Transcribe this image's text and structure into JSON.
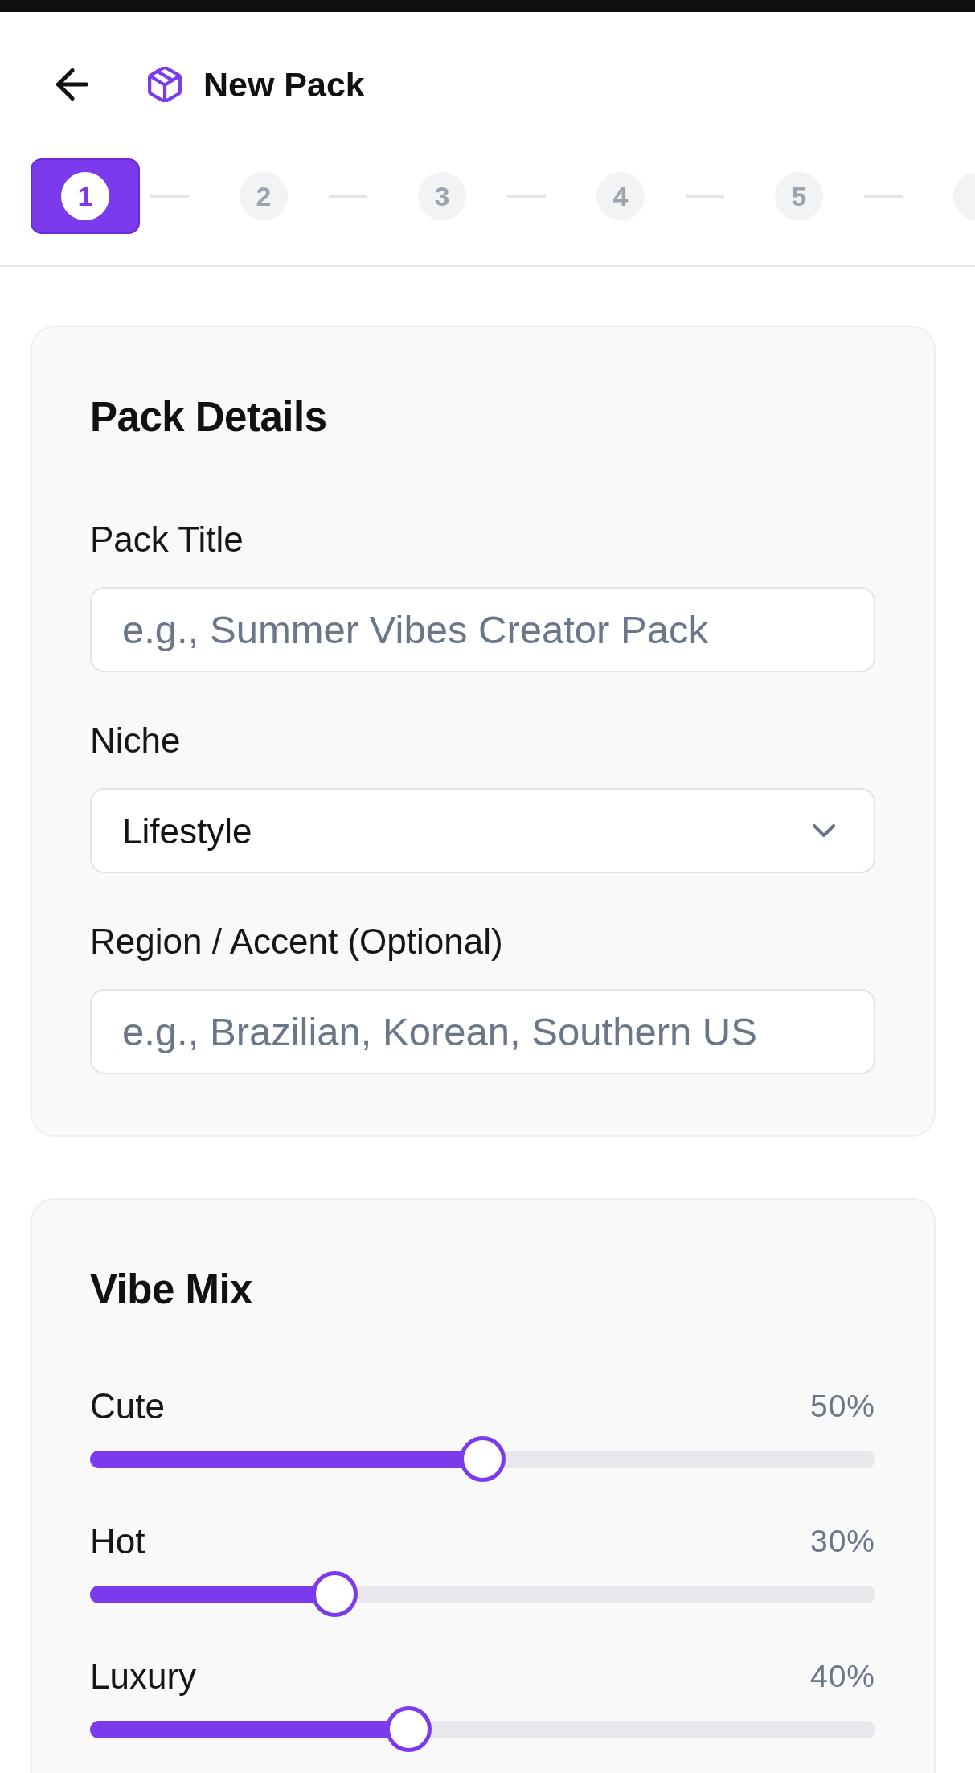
{
  "header": {
    "title": "New Pack"
  },
  "steps": [
    {
      "label": "1",
      "selected": true
    },
    {
      "label": "2",
      "selected": false
    },
    {
      "label": "3",
      "selected": false
    },
    {
      "label": "4",
      "selected": false
    },
    {
      "label": "5",
      "selected": false
    },
    {
      "selected": false
    }
  ],
  "pack_details": {
    "title": "Pack Details",
    "fields": [
      {
        "kind": "text",
        "label": "Pack Title",
        "placeholder": "e.g., Summer Vibes Creator Pack"
      },
      {
        "kind": "select",
        "label": "Niche",
        "value": "Lifestyle"
      },
      {
        "kind": "text",
        "label": "Region / Accent (Optional)",
        "placeholder": "e.g., Brazilian, Korean, Southern US"
      }
    ]
  },
  "vibe_mix": {
    "title": "Vibe Mix",
    "sliders": [
      {
        "label": "Cute",
        "reading": "50%",
        "level": 0.5
      },
      {
        "label": "Hot",
        "reading": "30%",
        "level": 0.3
      },
      {
        "label": "Luxury",
        "reading": "40%",
        "level": 0.4
      }
    ]
  }
}
